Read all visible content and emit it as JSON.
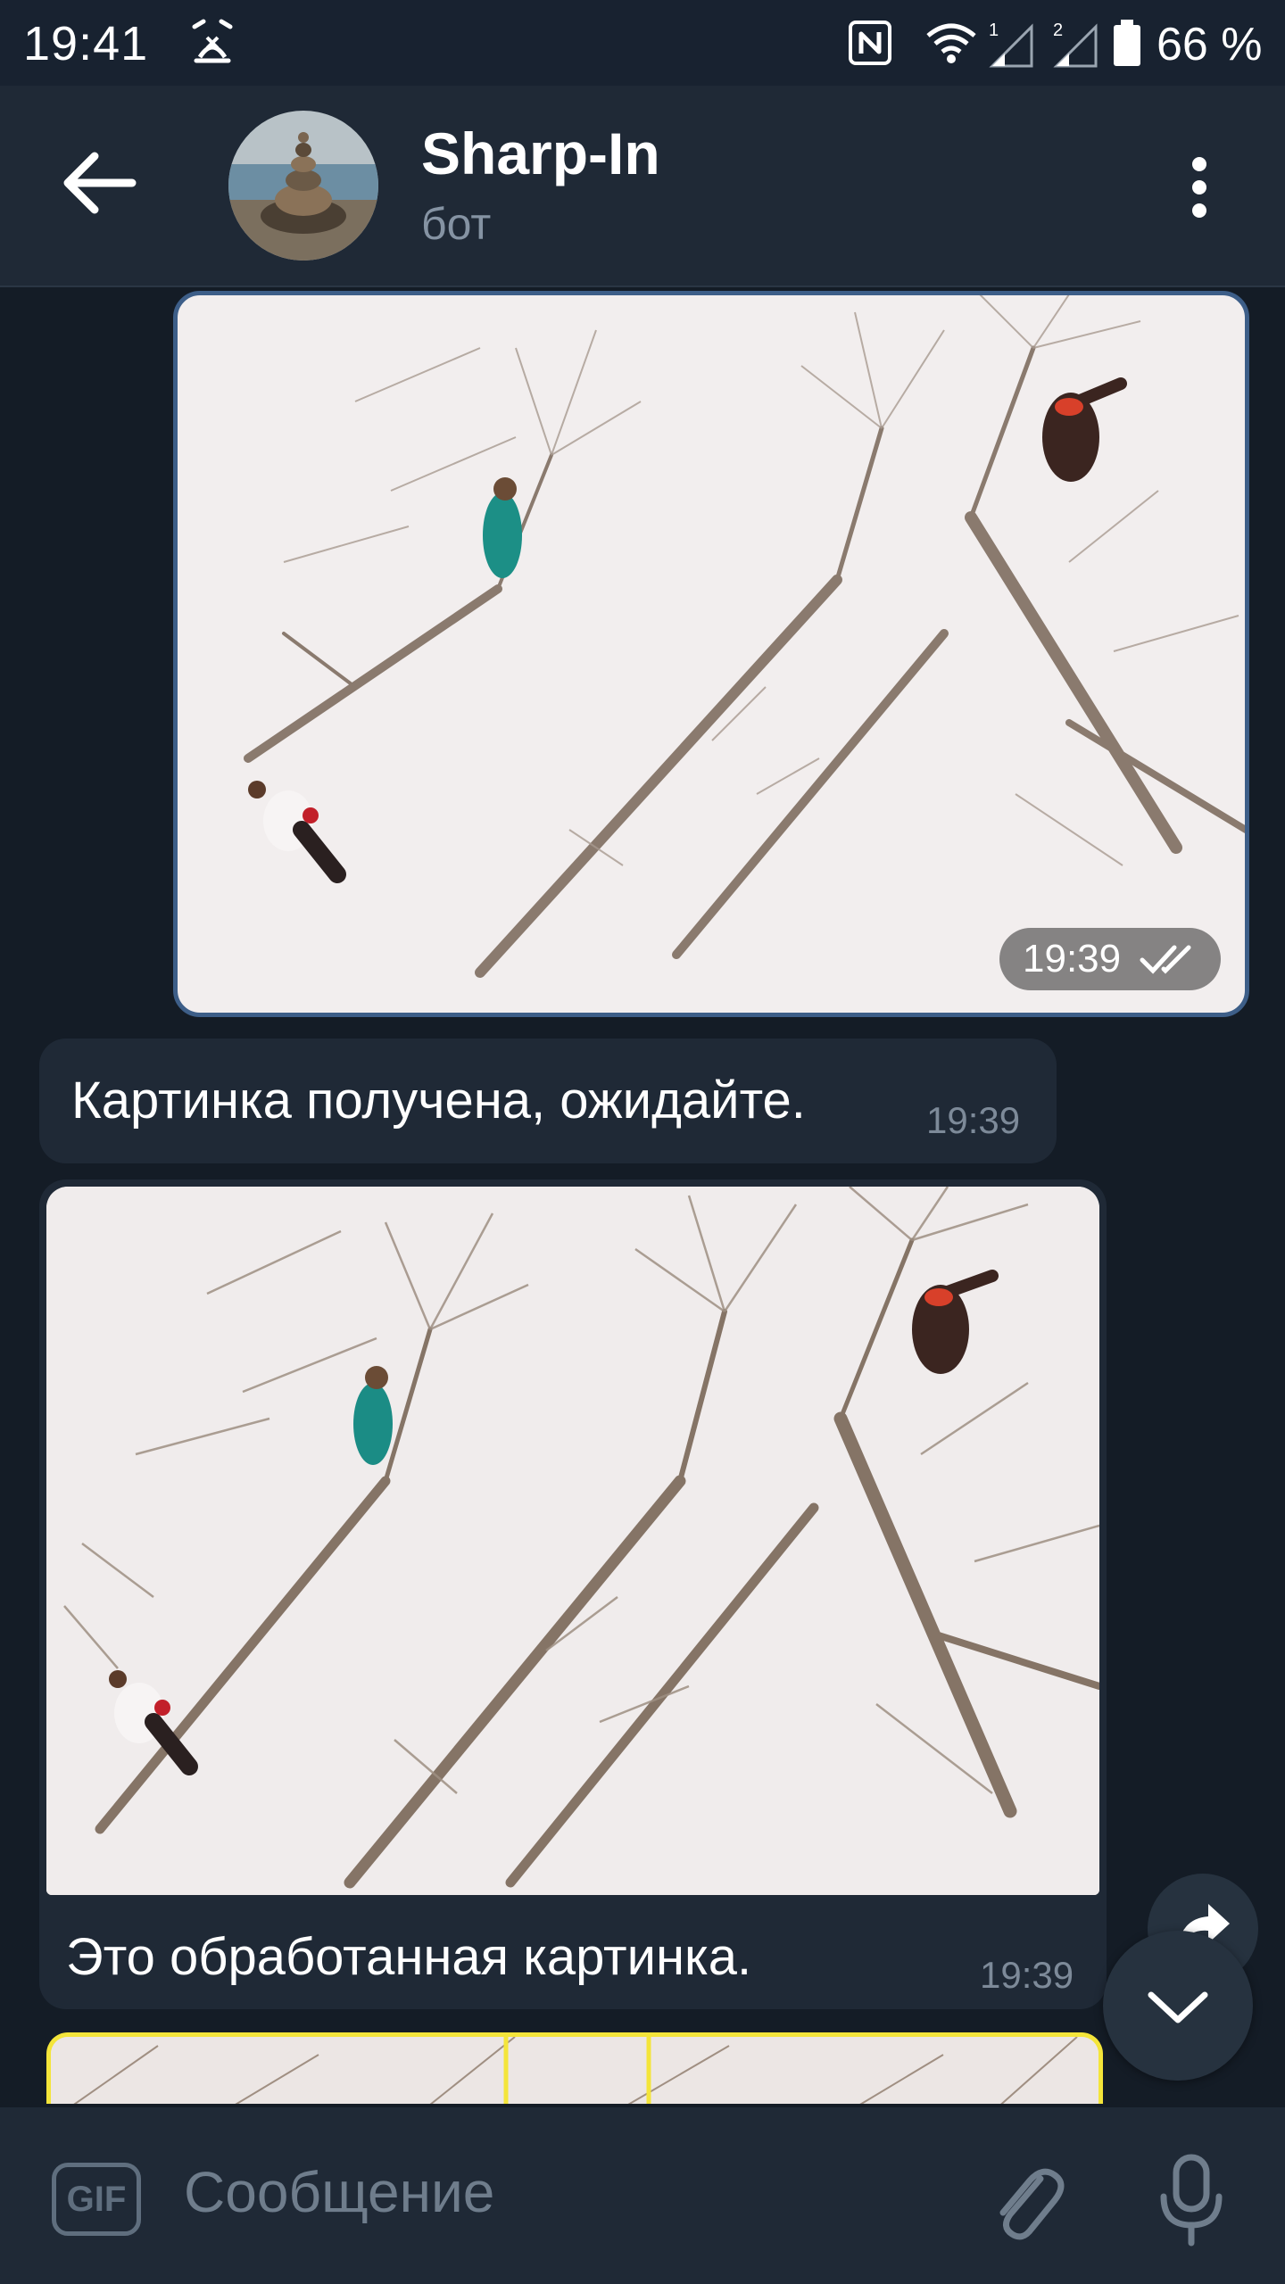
{
  "status_bar": {
    "time": "19:41",
    "battery": "66 %",
    "sim1": "1",
    "sim2": "2",
    "icons": [
      "alarm-off-icon",
      "nfc-icon",
      "wifi-icon",
      "signal-icon",
      "signal-icon",
      "battery-icon"
    ]
  },
  "header": {
    "title": "Sharp-In",
    "subtitle": "бот",
    "icons": [
      "back-arrow-icon",
      "more-vert-icon"
    ]
  },
  "messages": [
    {
      "type": "photo",
      "direction": "outgoing",
      "time": "19:39",
      "status": "read"
    },
    {
      "type": "text",
      "direction": "incoming",
      "text": "Картинка получена, ожидайте.",
      "time": "19:39"
    },
    {
      "type": "photo",
      "direction": "incoming",
      "caption": "Это обработанная картинка.",
      "time": "19:39"
    },
    {
      "type": "photo",
      "direction": "incoming"
    }
  ],
  "composer": {
    "gif_label": "GIF",
    "placeholder": "Сообщение",
    "icons": [
      "attach-icon",
      "microphone-icon"
    ]
  },
  "colors": {
    "background": "#141c26",
    "bar": "#1f2936",
    "outgoing_border": "#3d5e88",
    "highlight_yellow": "#f4e53a"
  }
}
